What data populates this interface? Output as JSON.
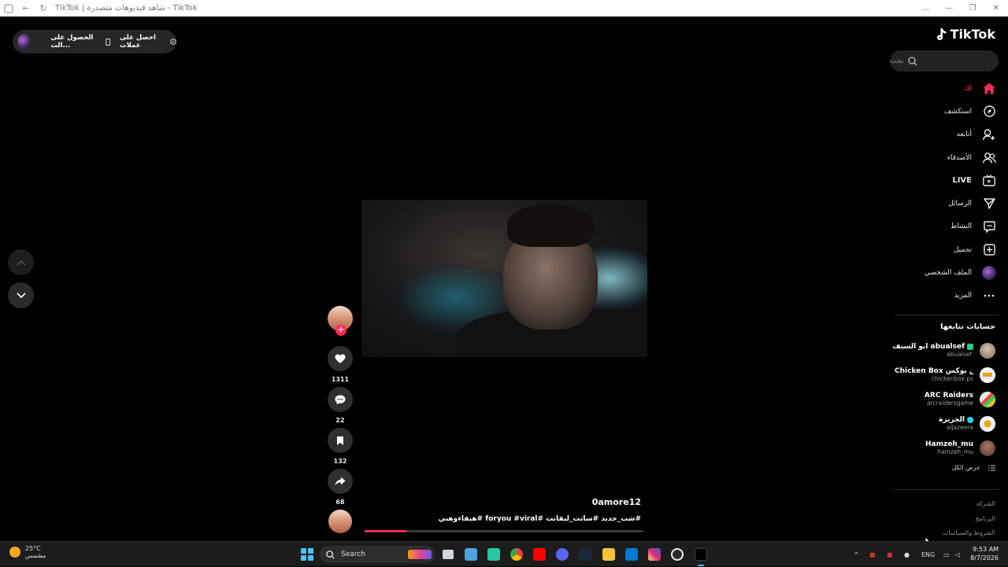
{
  "window": {
    "title": "TikTok | شاهد فيديوهات متصدرة - TikTok",
    "back_icon": "←",
    "forward_icon": "→",
    "reload_icon": "↻",
    "more_icon": "…",
    "minimize_icon": "—",
    "restore_icon": "❐",
    "close_icon": "✕"
  },
  "promo": {
    "coins_label": "احصل على عملات",
    "app_label": "الحصول على الت..."
  },
  "brand": {
    "logo_text": "TikTok"
  },
  "search": {
    "placeholder": "بحث"
  },
  "menu": {
    "items": [
      {
        "label": "لك",
        "icon": "home-icon",
        "active": true
      },
      {
        "label": "استكشف",
        "icon": "compass-icon"
      },
      {
        "label": "أتابعه",
        "icon": "user-plus-icon"
      },
      {
        "label": "الأصدقاء",
        "icon": "friends-icon"
      },
      {
        "label": "LIVE",
        "icon": "live-tv-icon"
      },
      {
        "label": "الرسائل",
        "icon": "send-icon"
      },
      {
        "label": "النشاط",
        "icon": "activity-icon"
      },
      {
        "label": "تحميل",
        "icon": "upload-icon"
      },
      {
        "label": "الملف الشخصي",
        "icon": "profile-avatar"
      },
      {
        "label": "المزيد",
        "icon": "more-dots-icon"
      }
    ]
  },
  "following": {
    "title": "حسابات تتابعها",
    "accounts": [
      {
        "name": "ابو السيف abualsef",
        "handle": "abualsef.",
        "badge_color": "#2ecc71",
        "avatar_color": "#c9b8a6"
      },
      {
        "name": "تشيكن بوكس Chicken Box",
        "name_display": "تشيكن بوكس Chicken Box",
        "handle": "chickenbox.ps",
        "avatar_color": "#f3f3f3"
      },
      {
        "name": "ARC Raiders",
        "handle": "arcraidersgame",
        "avatar_color": "#e8e8e8"
      },
      {
        "name": "الجزيرة",
        "handle": "aljazeera",
        "badge_color": "#20d5ec",
        "avatar_color": "#f2f2f2"
      },
      {
        "name": "Hamzeh_mu",
        "handle": "hamzeh_mu",
        "avatar_color": "#8a5a4a"
      }
    ],
    "see_all": "عرض الكل"
  },
  "footer_links": [
    "الشركة",
    "البرنامج",
    "الشروط والسياسات"
  ],
  "video": {
    "username": "0amore12",
    "tags": "#شب_جديد #ساتت_ليقانت #foryou #viral #هيفاءوهبي",
    "progress": 0.15
  },
  "actions": {
    "likes": "1311",
    "comments": "22",
    "saves": "132",
    "shares": "68"
  },
  "taskbar": {
    "temperature": "25°C",
    "weather": "مشمس",
    "search_label": "Search",
    "language": "ENG",
    "time": "9:53 AM",
    "date": "8/7/2026"
  }
}
